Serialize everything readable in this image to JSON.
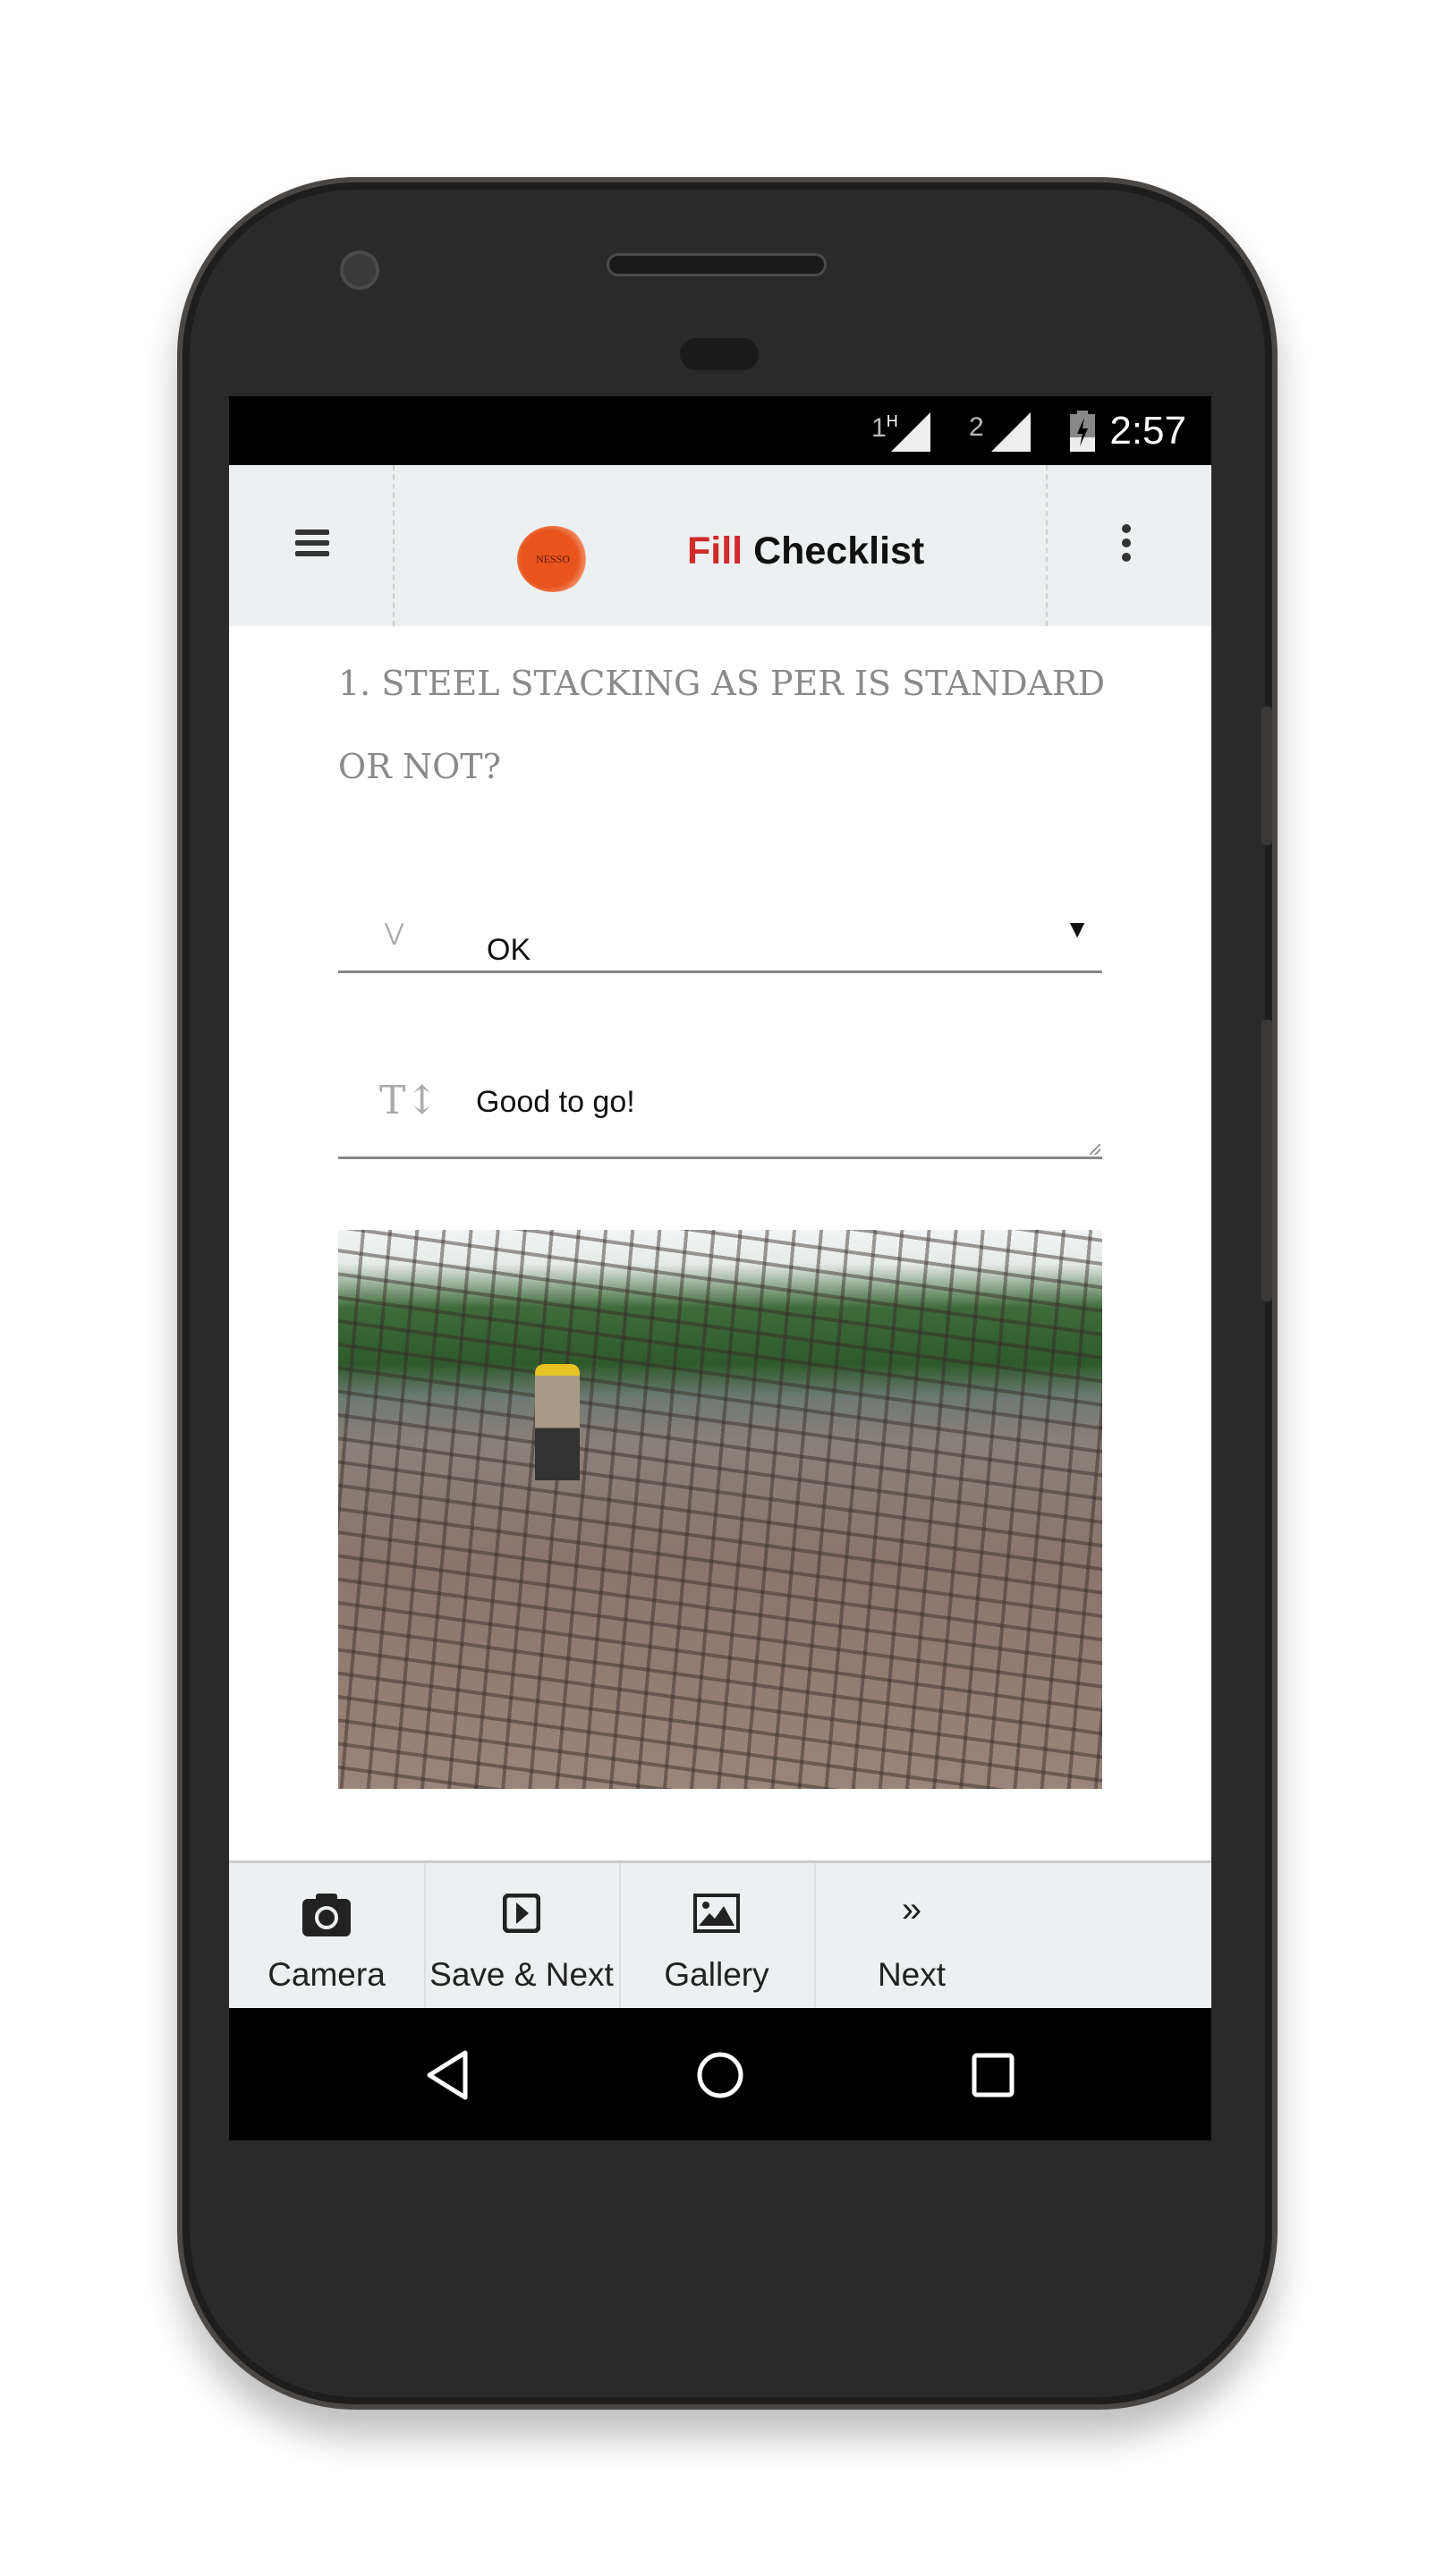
{
  "status_bar": {
    "sim1": "1",
    "sim1_network": "H",
    "sim2": "2",
    "time": "2:57",
    "icons": [
      "signal-icon",
      "signal-icon",
      "battery-charging-icon"
    ]
  },
  "header": {
    "title_highlight": "Fill",
    "title_rest": "Checklist",
    "logo_text": "NESSO",
    "accent_color": "#d02a2a",
    "icons": [
      "menu-icon",
      "more-vert-icon"
    ]
  },
  "question": {
    "text": "1. STEEL STACKING AS PER IS STANDARD OR NOT?"
  },
  "status_select": {
    "value": "OK",
    "icon": "double-chevron-down-icon"
  },
  "remarks": {
    "value": "Good to go!",
    "icon": "text-icon"
  },
  "bottom_bar": {
    "items": [
      {
        "label": "Camera",
        "icon": "camera-icon"
      },
      {
        "label": "Save & Next",
        "icon": "save-next-icon"
      },
      {
        "label": "Gallery",
        "icon": "gallery-icon"
      },
      {
        "label": "Next",
        "icon": "double-chevron-right-icon"
      }
    ]
  },
  "nav_bar": {
    "icons": [
      "back-icon",
      "home-icon",
      "recents-icon"
    ]
  }
}
